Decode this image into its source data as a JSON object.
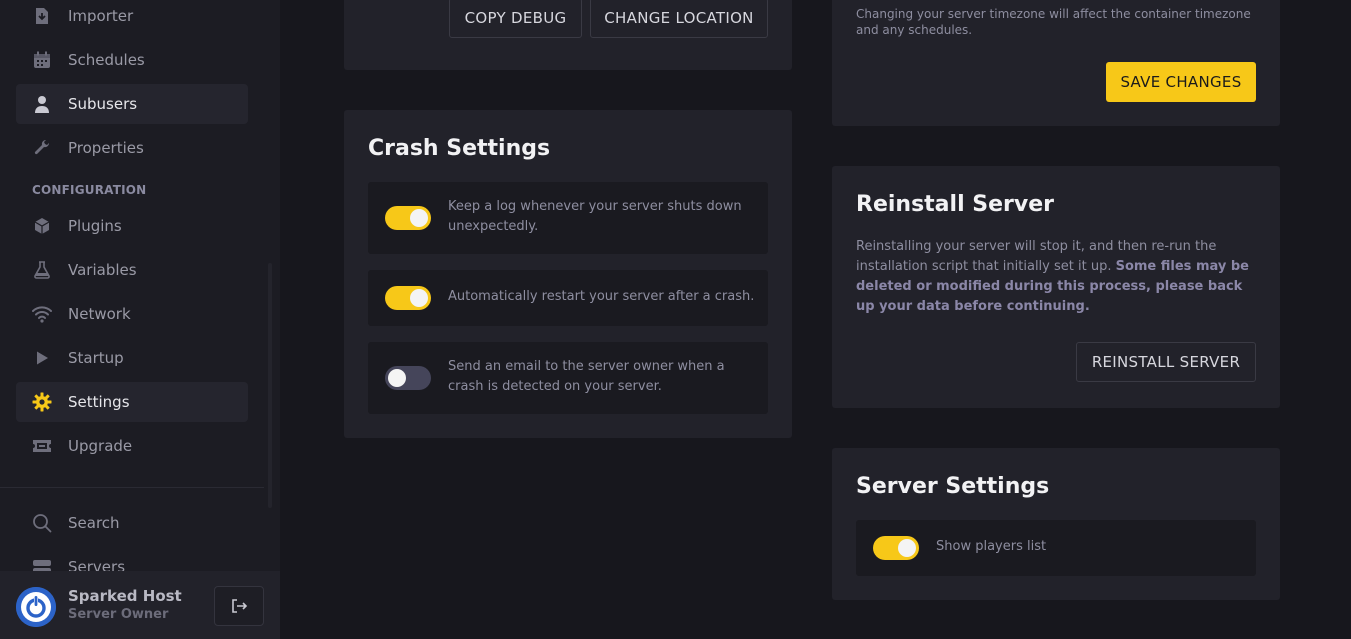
{
  "sidebar": {
    "items": [
      {
        "label": "Importer",
        "icon": "file-import-icon"
      },
      {
        "label": "Schedules",
        "icon": "calendar-icon"
      },
      {
        "label": "Subusers",
        "icon": "user-icon"
      },
      {
        "label": "Properties",
        "icon": "wrench-icon"
      },
      {
        "label": "Plugins",
        "icon": "cube-icon"
      },
      {
        "label": "Variables",
        "icon": "flask-icon"
      },
      {
        "label": "Network",
        "icon": "wifi-icon"
      },
      {
        "label": "Startup",
        "icon": "play-icon"
      },
      {
        "label": "Settings",
        "icon": "gear-icon"
      },
      {
        "label": "Upgrade",
        "icon": "ticket-icon"
      },
      {
        "label": "Search",
        "icon": "search-icon"
      },
      {
        "label": "Servers",
        "icon": "server-icon"
      }
    ],
    "section_label": "CONFIGURATION",
    "user": {
      "name": "Sparked Host",
      "role": "Server Owner"
    },
    "accent": "#f7c818"
  },
  "debug_panel": {
    "copy_debug": "COPY DEBUG",
    "change_location": "CHANGE LOCATION"
  },
  "timezone_panel": {
    "note": "Changing your server timezone will affect the container timezone and any schedules.",
    "save_label": "SAVE CHANGES"
  },
  "crash_settings": {
    "title": "Crash Settings",
    "rows": [
      {
        "text": "Keep a log whenever your server shuts down unexpectedly.",
        "enabled": true
      },
      {
        "text": "Automatically restart your server after a crash.",
        "enabled": true
      },
      {
        "text": "Send an email to the server owner when a crash is detected on your server.",
        "enabled": false
      }
    ]
  },
  "reinstall": {
    "title": "Reinstall Server",
    "desc_plain": "Reinstalling your server will stop it, and then re-run the installation script that initially set it up. ",
    "desc_bold": "Some files may be deleted or modified during this process, please back up your data before continuing.",
    "button": "REINSTALL SERVER"
  },
  "server_settings": {
    "title": "Server Settings",
    "rows": [
      {
        "text": "Show players list",
        "enabled": true
      }
    ]
  }
}
